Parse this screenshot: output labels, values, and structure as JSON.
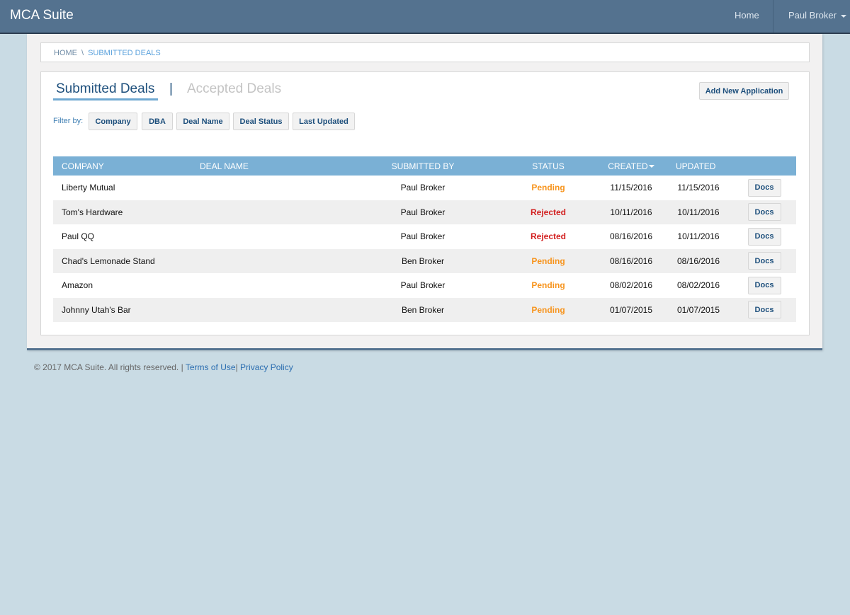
{
  "navbar": {
    "brand": "MCA Suite",
    "home_label": "Home",
    "user_label": "Paul Broker",
    "colors": {
      "bar": "#54728f"
    }
  },
  "breadcrumb": {
    "home": "HOME",
    "separator": "\\",
    "current": "SUBMITTED DEALS"
  },
  "tabs": [
    {
      "label": "Submitted Deals",
      "active": true
    },
    {
      "label": "Accepted Deals",
      "active": false
    }
  ],
  "tab_separator": "|",
  "add_button_label": "Add New Application",
  "filters": {
    "label": "Filter by:",
    "buttons": [
      "Company",
      "DBA",
      "Deal Name",
      "Deal Status",
      "Last Updated"
    ]
  },
  "table": {
    "columns": [
      "COMPANY",
      "DEAL NAME",
      "SUBMITTED BY",
      "STATUS",
      "CREATED",
      "UPDATED",
      ""
    ],
    "sorted_column": "CREATED",
    "sort_direction": "descending",
    "rows": [
      {
        "company": "Liberty Mutual",
        "deal_name": "",
        "submitted_by": "Paul Broker",
        "status": "Pending",
        "created": "11/15/2016",
        "updated": "11/15/2016",
        "action": "Docs"
      },
      {
        "company": "Tom's Hardware",
        "deal_name": "",
        "submitted_by": "Paul Broker",
        "status": "Rejected",
        "created": "10/11/2016",
        "updated": "10/11/2016",
        "action": "Docs"
      },
      {
        "company": "Paul QQ",
        "deal_name": "",
        "submitted_by": "Paul Broker",
        "status": "Rejected",
        "created": "08/16/2016",
        "updated": "10/11/2016",
        "action": "Docs"
      },
      {
        "company": "Chad's Lemonade Stand",
        "deal_name": "",
        "submitted_by": "Ben Broker",
        "status": "Pending",
        "created": "08/16/2016",
        "updated": "08/16/2016",
        "action": "Docs"
      },
      {
        "company": "Amazon",
        "deal_name": "",
        "submitted_by": "Paul Broker",
        "status": "Pending",
        "created": "08/02/2016",
        "updated": "08/02/2016",
        "action": "Docs"
      },
      {
        "company": "Johnny Utah's Bar",
        "deal_name": "",
        "submitted_by": "Ben Broker",
        "status": "Pending",
        "created": "01/07/2015",
        "updated": "01/07/2015",
        "action": "Docs"
      }
    ],
    "status_colors": {
      "Pending": "#f7941d",
      "Rejected": "#d21f1f"
    }
  },
  "footer": {
    "copyright": "© 2017 MCA Suite. All rights reserved.",
    "separator": "|",
    "terms": "Terms of Use",
    "privacy": "Privacy Policy"
  }
}
